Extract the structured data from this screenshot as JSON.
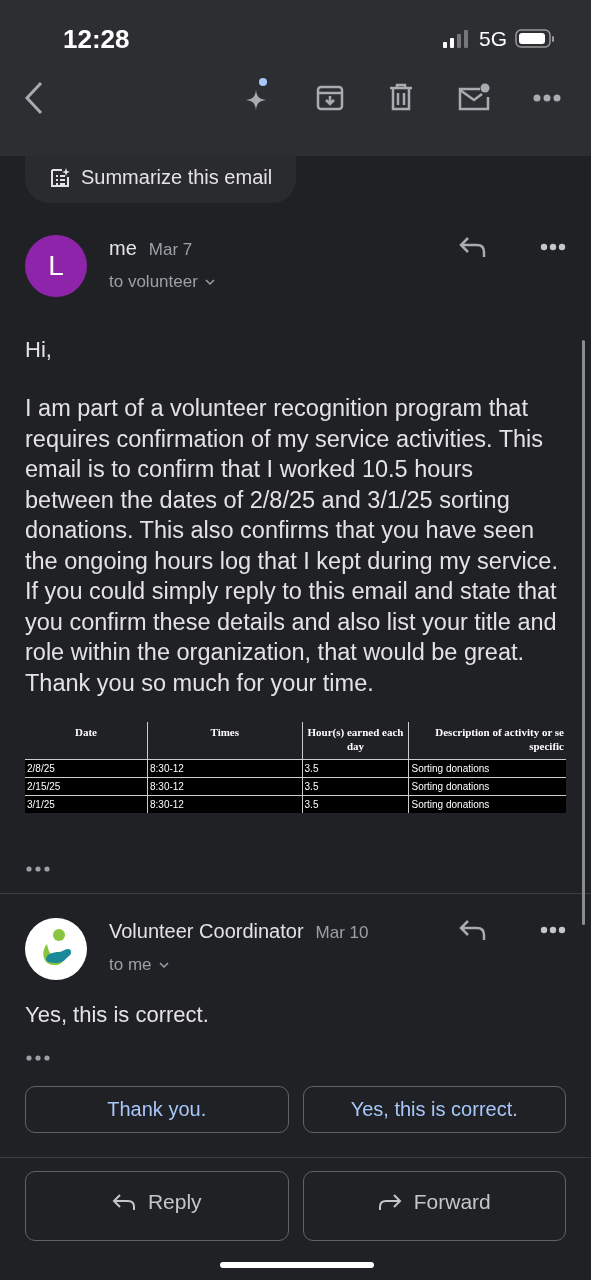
{
  "status_bar": {
    "time": "12:28",
    "network": "5G"
  },
  "toolbar": {
    "assistant_badge": true,
    "mail_badge": true
  },
  "summarize_button": "Summarize this email",
  "messages": [
    {
      "kind": "letter",
      "avatar_letter": "L",
      "sender": "me",
      "date": "Mar 7",
      "recipient": "to volunteer",
      "greeting": "Hi,",
      "body": "I am part of a volunteer recognition program that requires confirmation of my service activities. This email is to confirm that I worked 10.5 hours between the dates of 2/8/25 and 3/1/25 sorting donations. This also confirms that you have seen the ongoing hours log that I kept during my service. If you could simply reply to this email and state that you confirm these details and also list your title and role within the organization, that would be great. Thank you so much for your time.",
      "table": {
        "columns": [
          "Date",
          "Times",
          "Hour(s) earned each day",
          "Description of activity or se specific"
        ],
        "rows": [
          [
            "2/8/25",
            "8:30-12",
            "3.5",
            "Sorting donations"
          ],
          [
            "2/15/25",
            "8:30-12",
            "3.5",
            "Sorting donations"
          ],
          [
            "3/1/25",
            "8:30-12",
            "3.5",
            "Sorting donations"
          ]
        ]
      }
    },
    {
      "kind": "logo",
      "sender": "Volunteer Coordinator",
      "date": "Mar 10",
      "recipient": "to me",
      "body": "Yes, this is correct."
    }
  ],
  "smart_replies": [
    "Thank you.",
    "Yes, this is correct."
  ],
  "actions": [
    {
      "kind": "reply",
      "label": "Reply"
    },
    {
      "kind": "forward",
      "label": "Forward"
    }
  ]
}
